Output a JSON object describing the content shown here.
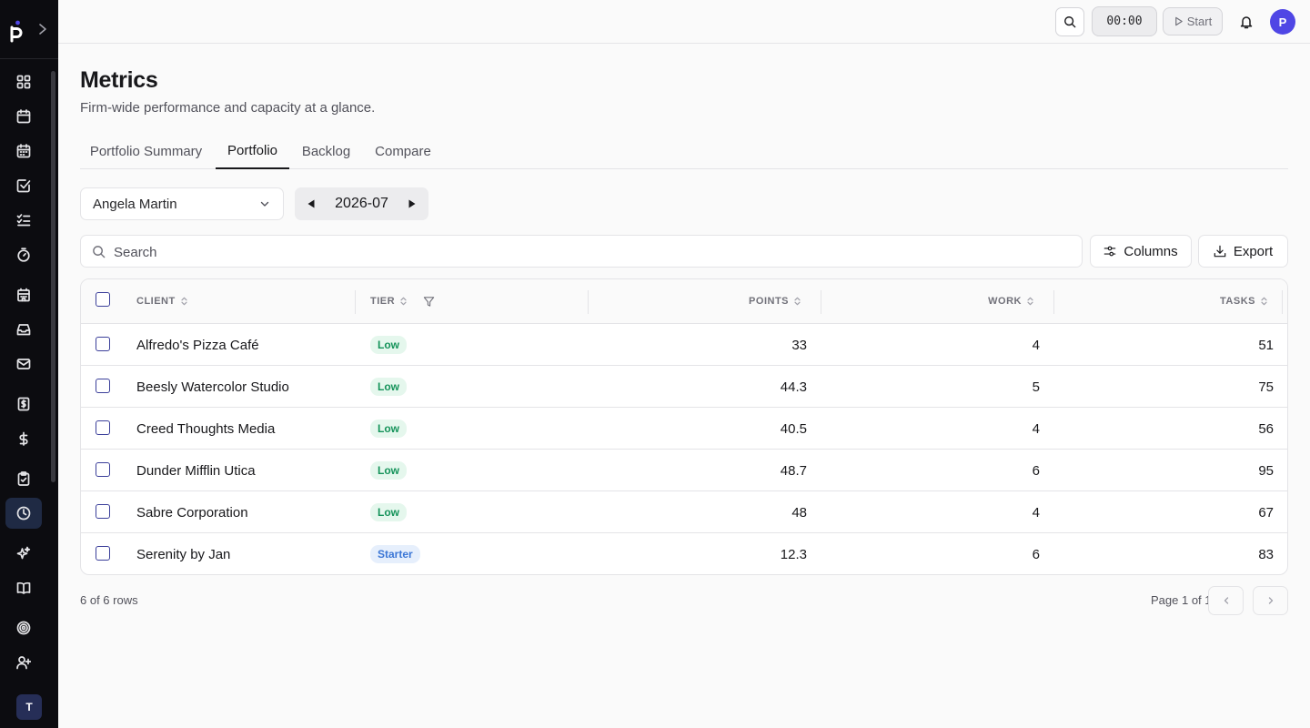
{
  "topbar": {
    "timer": "00:00",
    "start_label": "Start",
    "user_initial": "P"
  },
  "sidebar": {
    "team_initial": "T",
    "items": [
      {
        "icon": "dashboard-icon"
      },
      {
        "icon": "calendar-icon"
      },
      {
        "icon": "calendar-grid-icon"
      },
      {
        "icon": "checkbox-icon"
      },
      {
        "icon": "checklist-icon"
      },
      {
        "icon": "stopwatch-icon"
      },
      {
        "icon": "building-icon"
      },
      {
        "icon": "inbox-icon"
      },
      {
        "icon": "mail-icon"
      },
      {
        "icon": "invoice-icon"
      },
      {
        "icon": "dollar-icon"
      },
      {
        "icon": "clipboard-icon"
      },
      {
        "icon": "clock-icon",
        "active": true
      },
      {
        "icon": "sparkles-icon"
      },
      {
        "icon": "book-icon"
      },
      {
        "icon": "target-icon"
      },
      {
        "icon": "user-plus-icon"
      }
    ]
  },
  "page": {
    "title": "Metrics",
    "subtitle": "Firm-wide performance and capacity at a glance."
  },
  "tabs": [
    {
      "label": "Portfolio Summary",
      "active": false
    },
    {
      "label": "Portfolio",
      "active": true
    },
    {
      "label": "Backlog",
      "active": false
    },
    {
      "label": "Compare",
      "active": false
    }
  ],
  "filters": {
    "person": "Angela Martin",
    "month": "2026-07"
  },
  "search": {
    "placeholder": "Search",
    "value": ""
  },
  "toolbar": {
    "columns_label": "Columns",
    "export_label": "Export"
  },
  "table": {
    "headers": {
      "client": "CLIENT",
      "tier": "TIER",
      "points": "POINTS",
      "work": "WORK",
      "tasks": "TASKS"
    },
    "rows": [
      {
        "client": "Alfredo's Pizza Café",
        "tier": "Low",
        "points": "33",
        "work": "4",
        "tasks": "51"
      },
      {
        "client": "Beesly Watercolor Studio",
        "tier": "Low",
        "points": "44.3",
        "work": "5",
        "tasks": "75"
      },
      {
        "client": "Creed Thoughts Media",
        "tier": "Low",
        "points": "40.5",
        "work": "4",
        "tasks": "56"
      },
      {
        "client": "Dunder Mifflin Utica",
        "tier": "Low",
        "points": "48.7",
        "work": "6",
        "tasks": "95"
      },
      {
        "client": "Sabre Corporation",
        "tier": "Low",
        "points": "48",
        "work": "4",
        "tasks": "67"
      },
      {
        "client": "Serenity by Jan",
        "tier": "Starter",
        "points": "12.3",
        "work": "6",
        "tasks": "83"
      }
    ]
  },
  "footer": {
    "rows_count": "6 of 6 rows",
    "page_info": "Page 1 of 1"
  },
  "colors": {
    "sidebar_bg": "#0c0c10",
    "accent": "#4f46e5",
    "tier_low": "#15935a",
    "tier_starter": "#3c77d6"
  }
}
